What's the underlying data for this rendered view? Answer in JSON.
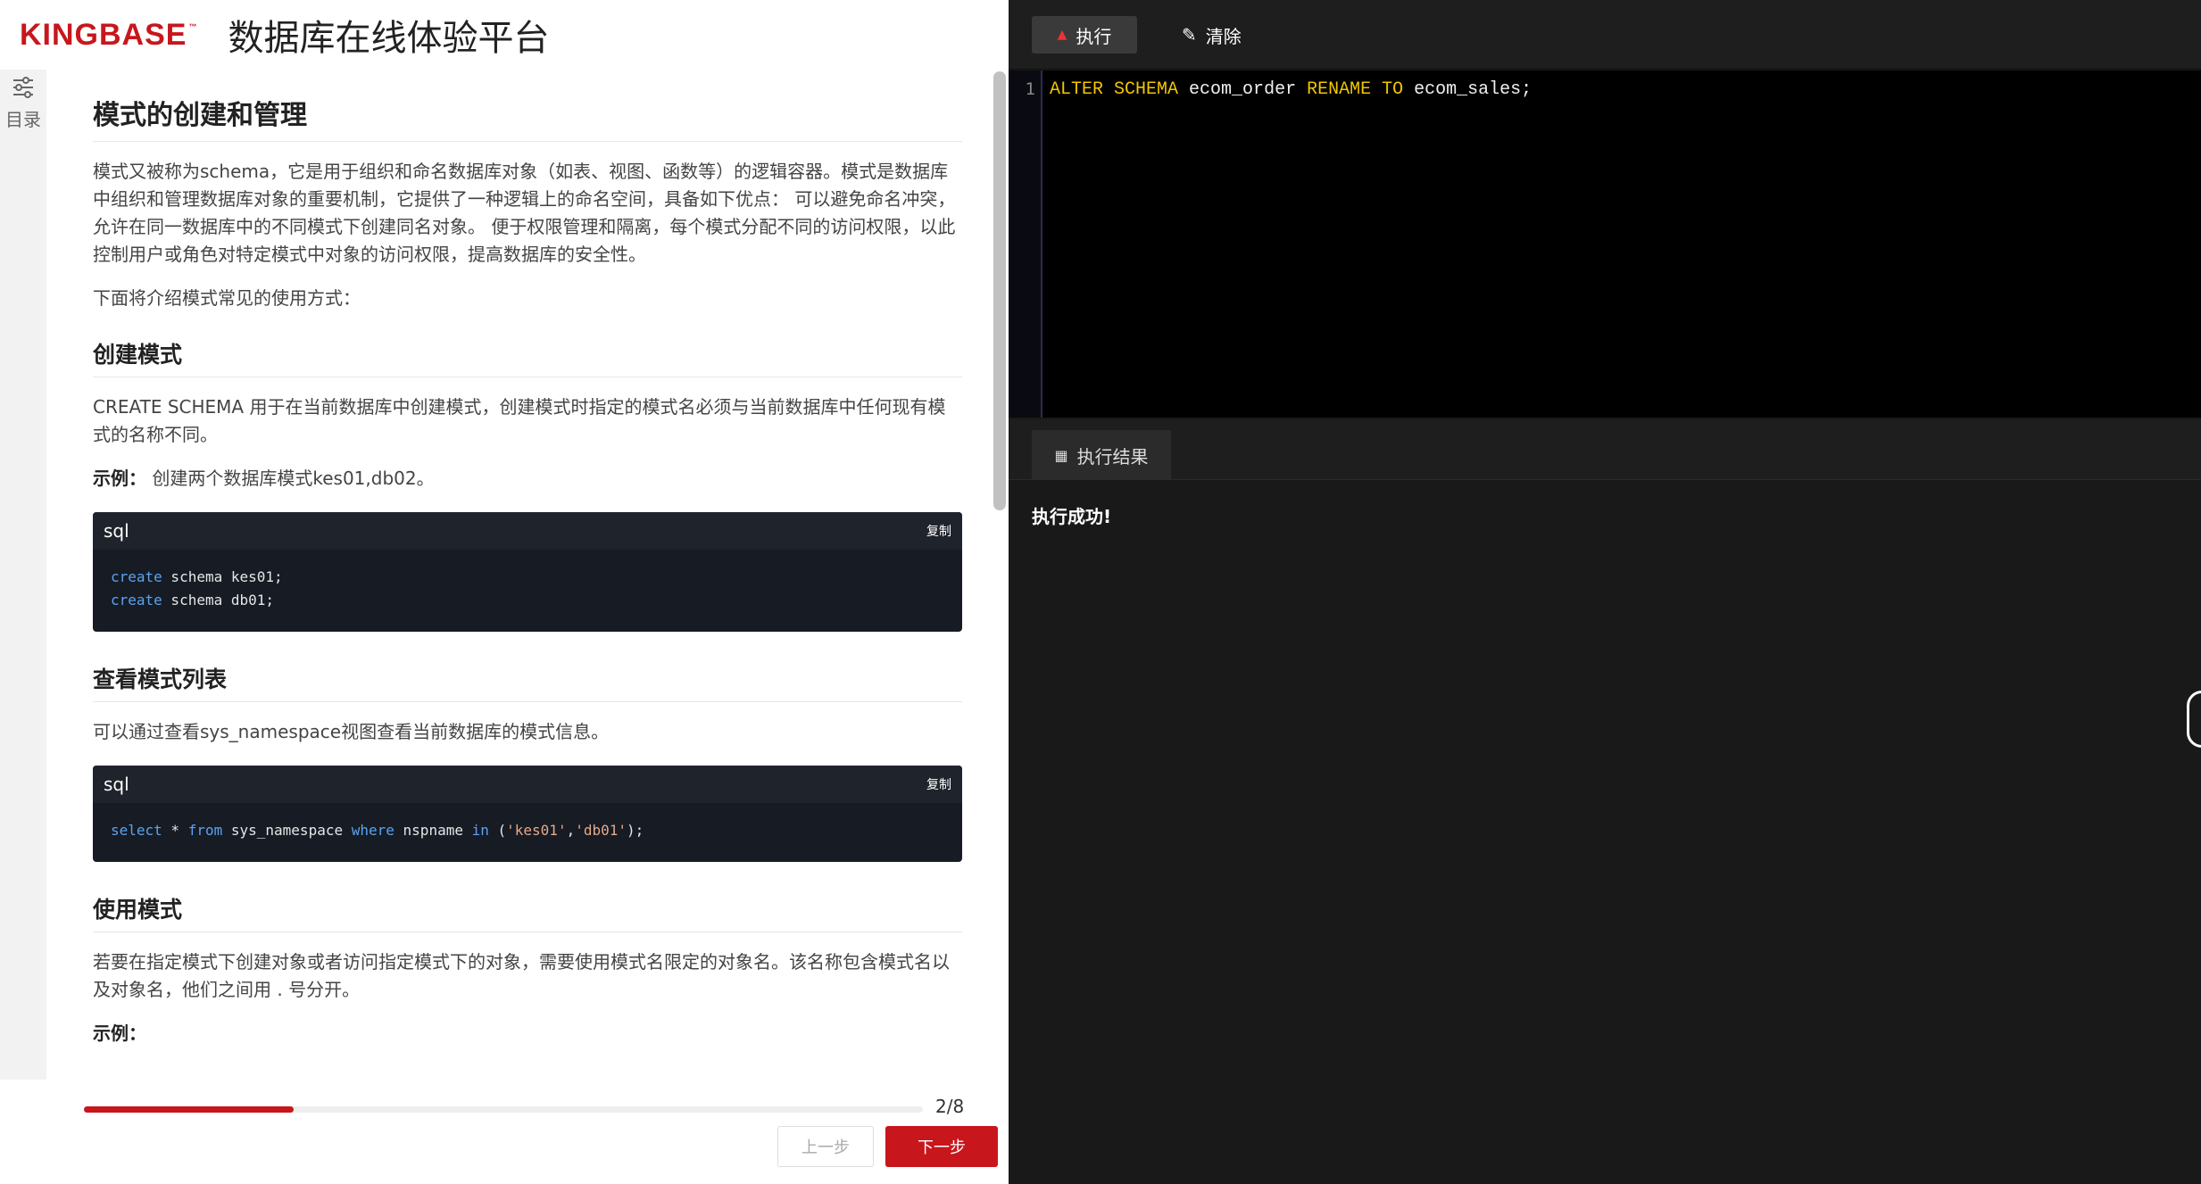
{
  "header": {
    "logo_text": "KINGBASE",
    "logo_tm": "™",
    "title": "数据库在线体验平台"
  },
  "toc": {
    "label": "目录",
    "icon": "sliders-icon"
  },
  "article": {
    "title": "模式的创建和管理",
    "intro": "模式又被称为schema，它是用于组织和命名数据库对象（如表、视图、函数等）的逻辑容器。模式是数据库中组织和管理数据库对象的重要机制，它提供了一种逻辑上的命名空间，具备如下优点： 可以避免命名冲突，允许在同一数据库中的不同模式下创建同名对象。 便于权限管理和隔离，每个模式分配不同的访问权限，以此控制用户或角色对特定模式中对象的访问权限，提高数据库的安全性。",
    "intro2": "下面将介绍模式常见的使用方式：",
    "sections": [
      {
        "heading": "创建模式",
        "text": "CREATE SCHEMA 用于在当前数据库中创建模式，创建模式时指定的模式名必须与当前数据库中任何现有模式的名称不同。",
        "example_label": "示例：",
        "example_text": "创建两个数据库模式kes01,db02。",
        "code": {
          "lang": "sql",
          "copy": "复制",
          "lines": [
            {
              "kw": "create",
              "rest": " schema kes01;"
            },
            {
              "kw": "create",
              "rest": " schema db01;"
            }
          ]
        }
      },
      {
        "heading": "查看模式列表",
        "text": "可以通过查看sys_namespace视图查看当前数据库的模式信息。",
        "code": {
          "lang": "sql",
          "copy": "复制",
          "tokens": [
            {
              "t": "select",
              "c": "kw"
            },
            {
              "t": " * ",
              "c": ""
            },
            {
              "t": "from",
              "c": "kw"
            },
            {
              "t": " sys_namespace ",
              "c": ""
            },
            {
              "t": "where",
              "c": "kw"
            },
            {
              "t": " nspname ",
              "c": ""
            },
            {
              "t": "in",
              "c": "kw"
            },
            {
              "t": " (",
              "c": ""
            },
            {
              "t": "'kes01'",
              "c": "str"
            },
            {
              "t": ",",
              "c": ""
            },
            {
              "t": "'db01'",
              "c": "str"
            },
            {
              "t": ");",
              "c": ""
            }
          ]
        }
      },
      {
        "heading": "使用模式",
        "text": "若要在指定模式下创建对象或者访问指定模式下的对象，需要使用模式名限定的对象名。该名称包含模式名以及对象名，他们之间用 . 号分开。",
        "example_label": "示例："
      }
    ]
  },
  "pager": {
    "progress": 0.25,
    "progress_text": "2/8",
    "prev_label": "上一步",
    "next_label": "下一步"
  },
  "toolbar": {
    "run_label": "执行",
    "clear_label": "清除"
  },
  "editor": {
    "line_number": "1",
    "tokens": [
      {
        "t": "ALTER",
        "c": "sqlkw"
      },
      {
        "t": " ",
        "c": ""
      },
      {
        "t": "SCHEMA",
        "c": "sqlkw"
      },
      {
        "t": " ecom_order ",
        "c": ""
      },
      {
        "t": "RENAME",
        "c": "sqlkw"
      },
      {
        "t": " ",
        "c": ""
      },
      {
        "t": "TO",
        "c": "sqlkw"
      },
      {
        "t": " ecom_sales;",
        "c": ""
      }
    ]
  },
  "result": {
    "tab_label": "执行结果",
    "message": "执行成功!"
  },
  "colors": {
    "brand": "#c8161d",
    "sql_keyword": "#f2c600",
    "code_keyword": "#5aa3f0",
    "code_string": "#e8a78a"
  }
}
